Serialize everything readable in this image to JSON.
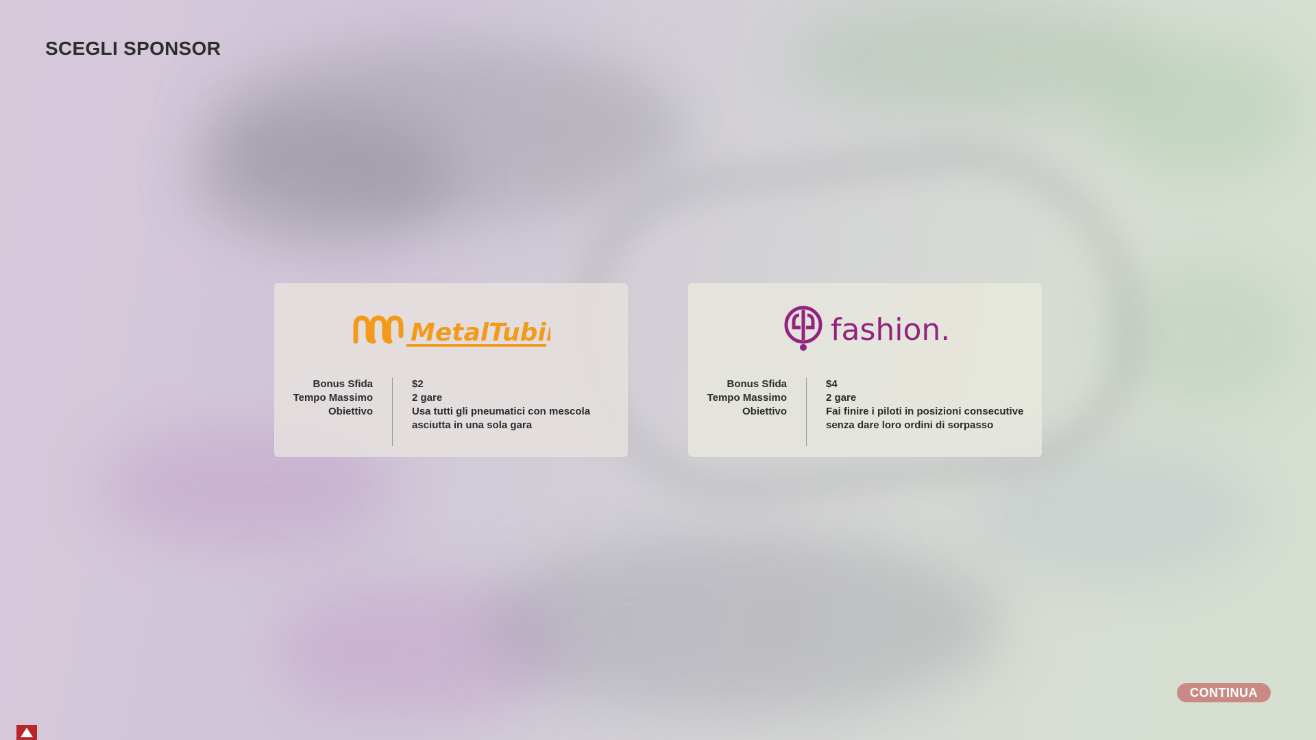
{
  "page": {
    "title": "SCEGLI SPONSOR"
  },
  "sponsors": [
    {
      "name": "MetalTubing",
      "logo_text": "MetalTubing",
      "brand_color": "#f39a1a",
      "labels": {
        "bonus": "Bonus Sfida",
        "time": "Tempo Massimo",
        "goal": "Obiettivo"
      },
      "bonus": "$2",
      "time": "2 gare",
      "goal": "Usa tutti gli pneumatici con mescola asciutta in una sola gara"
    },
    {
      "name": "fashion.",
      "logo_text": "fashion.",
      "brand_color": "#93237f",
      "labels": {
        "bonus": "Bonus Sfida",
        "time": "Tempo Massimo",
        "goal": "Obiettivo"
      },
      "bonus": "$4",
      "time": "2 gare",
      "goal": "Fai finire i piloti in posizioni consecutive senza dare loro ordini di sorpasso"
    }
  ],
  "footer": {
    "continue_label": "CONTINUA",
    "continue_color": "#c98a86",
    "warning_icon": "warning-triangle-icon",
    "warning_color": "#b8262b"
  }
}
